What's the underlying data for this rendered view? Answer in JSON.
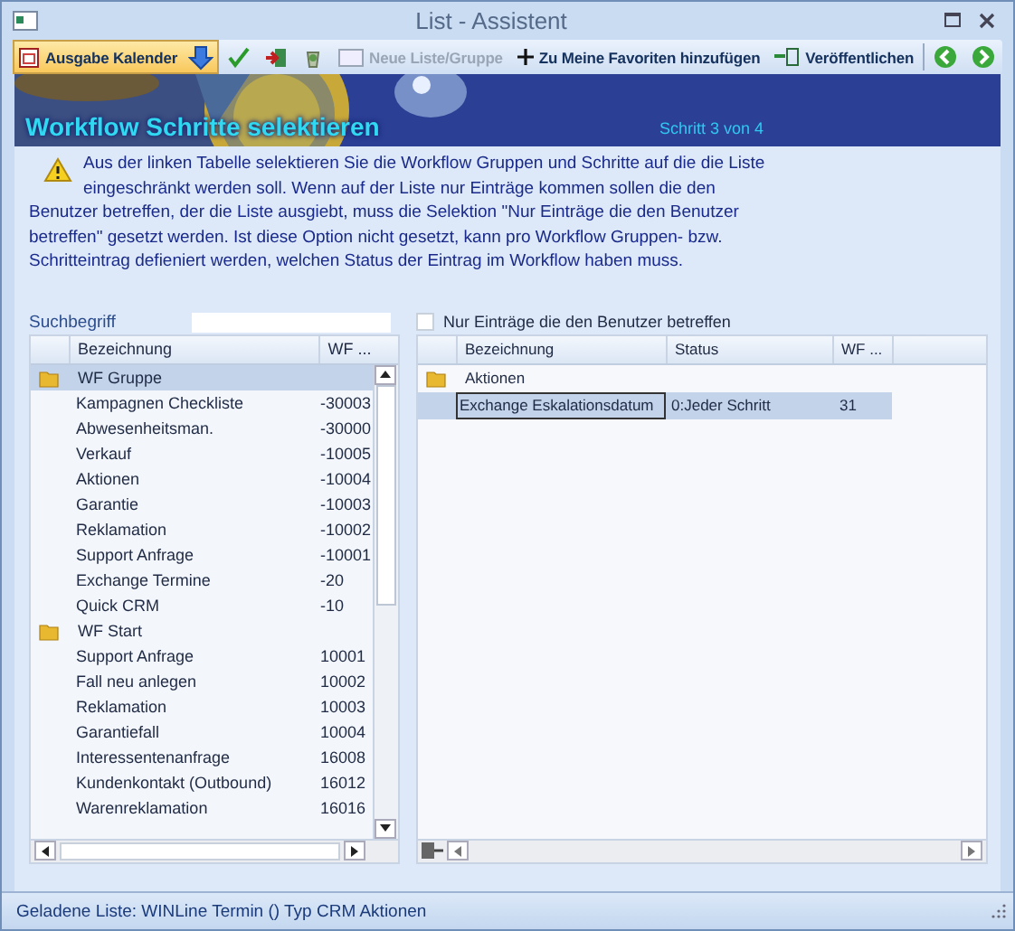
{
  "window": {
    "title": "List - Assistent"
  },
  "toolbar": [
    {
      "kind": "calendar",
      "label": "Ausgabe Kalender",
      "selected": true
    },
    {
      "kind": "check"
    },
    {
      "kind": "exit"
    },
    {
      "kind": "recycle"
    },
    {
      "kind": "new",
      "label": "Neue Liste/Gruppe",
      "disabled": true
    },
    {
      "kind": "plus",
      "label": "Zu Meine Favoriten hinzufügen"
    },
    {
      "kind": "publish",
      "label": "Veröffentlichen"
    },
    {
      "kind": "back"
    },
    {
      "kind": "forward"
    }
  ],
  "banner": {
    "title": "Workflow Schritte selektieren",
    "step": "Schritt 3 von 4"
  },
  "info": {
    "text": "Aus der linken Tabelle selektieren Sie die Workflow Gruppen und Schritte auf die die Liste eingeschränkt werden soll. Wenn auf der Liste nur Einträge kommen sollen die den Benutzer betreffen, der die Liste ausgiebt, muss die Selektion \"Nur Einträge die den Benutzer betreffen\" gesetzt werden. Ist diese Option nicht gesetzt, kann pro Workflow Gruppen- bzw. Schritteintrag defieniert werden, welchen Status der Eintrag im Workflow haben muss."
  },
  "left_table": {
    "search_label": "Suchbegriff",
    "columns": [
      "Bezeichnung",
      "WF ..."
    ],
    "rows": [
      {
        "name": "WF Gruppe",
        "selected": true,
        "children": [
          {
            "name": "Kampagnen Checkliste",
            "wf": "-30003",
            "selected": false
          },
          {
            "name": "Abwesenheitsman.",
            "wf": "-30000",
            "selected": false
          },
          {
            "name": "Verkauf",
            "wf": "-10005",
            "selected": false
          },
          {
            "name": "Aktionen",
            "wf": "-10004",
            "selected": false
          },
          {
            "name": "Garantie",
            "wf": "-10003",
            "selected": false
          },
          {
            "name": "Reklamation",
            "wf": "-10002",
            "selected": false
          },
          {
            "name": "Support Anfrage",
            "wf": "-10001",
            "selected": false
          },
          {
            "name": "Exchange Termine",
            "wf": "-20",
            "selected": false
          },
          {
            "name": "Quick CRM",
            "wf": "-10",
            "selected": false
          }
        ]
      },
      {
        "name": "WF Start",
        "selected": false,
        "children": [
          {
            "name": "Support Anfrage",
            "wf": "10001",
            "selected": false
          },
          {
            "name": "Fall neu anlegen",
            "wf": "10002",
            "selected": false
          },
          {
            "name": "Reklamation",
            "wf": "10003",
            "selected": false
          },
          {
            "name": "Garantiefall",
            "wf": "10004",
            "selected": false
          },
          {
            "name": "Interessentenanfrage",
            "wf": "16008",
            "selected": false
          },
          {
            "name": "Kundenkontakt (Outbound)",
            "wf": "16012",
            "selected": false
          },
          {
            "name": "Warenreklamation",
            "wf": "16016",
            "selected": false
          }
        ]
      }
    ]
  },
  "right_table": {
    "filter": {
      "label": "Nur Einträge die den Benutzer betreffen",
      "checked": false
    },
    "columns": [
      "Bezeichnung",
      "Status",
      "WF ..."
    ],
    "rows": [
      {
        "name": "Aktionen",
        "selected": false,
        "children": [
          {
            "name": "Exchange Eskalationsdatum",
            "status": "0:Jeder Schritt",
            "wf": "31",
            "selected": true
          }
        ]
      }
    ]
  },
  "status_bar": {
    "text": "Geladene Liste: WINLine Termin () Typ CRM Aktionen"
  }
}
